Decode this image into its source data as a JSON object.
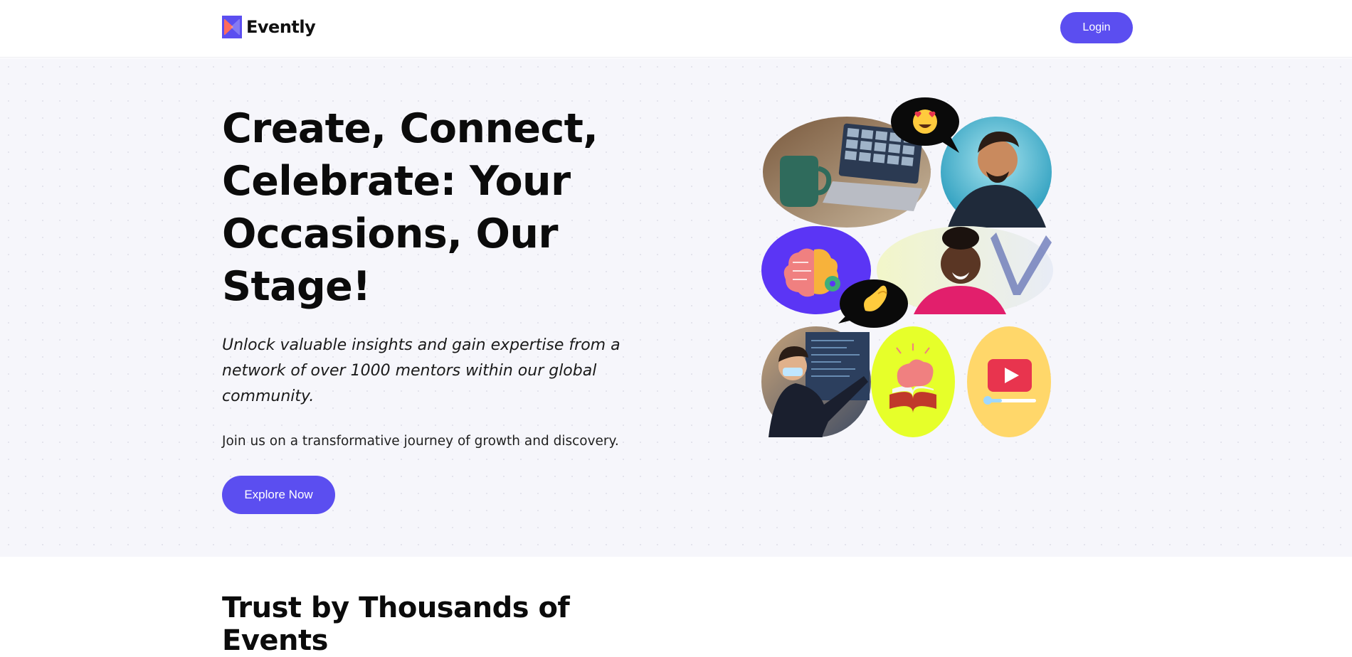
{
  "header": {
    "brand": "Evently",
    "login_label": "Login"
  },
  "hero": {
    "title": "Create, Connect, Celebrate: Your Occasions, Our Stage!",
    "subtitle": "Unlock valuable insights and gain expertise from a network of over 1000 mentors within our global community.",
    "join_text": "Join us on a transformative journey of growth and discovery.",
    "cta_label": "Explore Now"
  },
  "collage": {
    "tiles": [
      {
        "subject": "laptop with video call and mug",
        "icon": "photo-laptop-call"
      },
      {
        "subject": "smiling man looking up",
        "icon": "photo-man-smiling"
      },
      {
        "subject": "brain with gear illustration",
        "icon": "brain-gear-icon"
      },
      {
        "subject": "laughing woman",
        "icon": "photo-woman-laughing"
      },
      {
        "subject": "presenter pointing at screen",
        "icon": "photo-presenter"
      },
      {
        "subject": "brain over open book illustration",
        "icon": "brain-book-icon"
      },
      {
        "subject": "video play illustration",
        "icon": "video-play-icon"
      }
    ],
    "bubbles": [
      {
        "emoji": "😍",
        "icon": "heart-eyes-emoji-icon"
      },
      {
        "emoji": "🤌",
        "icon": "pinched-fingers-emoji-icon"
      }
    ]
  },
  "colors": {
    "accent": "#5b4ef0",
    "hero_bg": "#f6f6fb",
    "lime": "#e6ff2a",
    "yellow": "#ffd76a",
    "purple_tile": "#5b35f5"
  },
  "trust": {
    "title": "Trust by Thousands of Events"
  }
}
